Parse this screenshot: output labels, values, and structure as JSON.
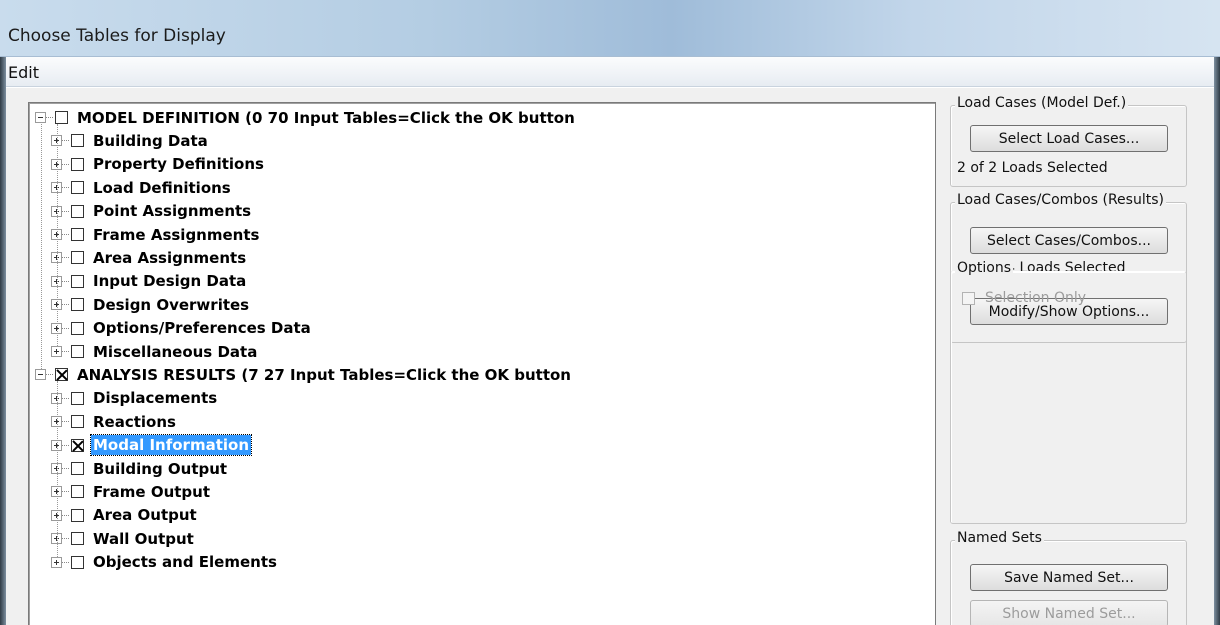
{
  "window": {
    "title": "Choose Tables for Display"
  },
  "menu": {
    "items": [
      "Edit"
    ]
  },
  "tree": {
    "nodes": [
      {
        "label": "MODEL DEFINITION  (0  70 Input Tables=Click the OK button",
        "level": 0,
        "checked": false,
        "selected": false
      },
      {
        "label": "Building Data",
        "level": 1,
        "checked": false,
        "selected": false
      },
      {
        "label": "Property Definitions",
        "level": 1,
        "checked": false,
        "selected": false
      },
      {
        "label": "Load Definitions",
        "level": 1,
        "checked": false,
        "selected": false
      },
      {
        "label": "Point Assignments",
        "level": 1,
        "checked": false,
        "selected": false
      },
      {
        "label": "Frame Assignments",
        "level": 1,
        "checked": false,
        "selected": false
      },
      {
        "label": "Area Assignments",
        "level": 1,
        "checked": false,
        "selected": false
      },
      {
        "label": "Input Design Data",
        "level": 1,
        "checked": false,
        "selected": false
      },
      {
        "label": "Design Overwrites",
        "level": 1,
        "checked": false,
        "selected": false
      },
      {
        "label": "Options/Preferences Data",
        "level": 1,
        "checked": false,
        "selected": false
      },
      {
        "label": "Miscellaneous Data",
        "level": 1,
        "checked": false,
        "selected": false
      },
      {
        "label": "ANALYSIS RESULTS  (7  27 Input Tables=Click the OK button",
        "level": 0,
        "checked": true,
        "selected": false
      },
      {
        "label": "Displacements",
        "level": 1,
        "checked": false,
        "selected": false
      },
      {
        "label": "Reactions",
        "level": 1,
        "checked": false,
        "selected": false
      },
      {
        "label": "Modal Information",
        "level": 1,
        "checked": true,
        "selected": true
      },
      {
        "label": "Building Output",
        "level": 1,
        "checked": false,
        "selected": false
      },
      {
        "label": "Frame Output",
        "level": 1,
        "checked": false,
        "selected": false
      },
      {
        "label": "Area Output",
        "level": 1,
        "checked": false,
        "selected": false
      },
      {
        "label": "Wall Output",
        "level": 1,
        "checked": false,
        "selected": false
      },
      {
        "label": "Objects and Elements",
        "level": 1,
        "checked": false,
        "selected": false
      }
    ]
  },
  "load_cases": {
    "legend": "Load Cases (Model Def.)",
    "button": "Select Load Cases...",
    "status": "2  of  2  Loads Selected"
  },
  "load_combos": {
    "legend": "Load Cases/Combos (Results)",
    "button": "Select Cases/Combos...",
    "status": "14  of  14  Loads Selected",
    "options_button": "Modify/Show Options..."
  },
  "options": {
    "legend": "Options",
    "selection_only": "Selection Only"
  },
  "named_sets": {
    "legend": "Named Sets",
    "save_button": "Save Named Set...",
    "show_button": "Show Named Set..."
  }
}
